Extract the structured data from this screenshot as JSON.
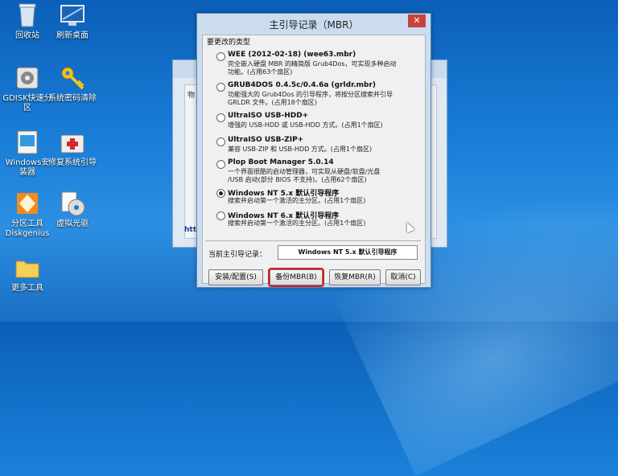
{
  "desktop": {
    "icons": [
      {
        "label": "回收站"
      },
      {
        "label": "刷新桌面"
      },
      {
        "label": "GDISK快速分\n区"
      },
      {
        "label": "系统密码清除"
      },
      {
        "label": "Windows安\n装器"
      },
      {
        "label": "修复系统引导"
      },
      {
        "label": "分区工具\nDiskgenius"
      },
      {
        "label": "虚拟光驱"
      },
      {
        "label": "更多工具"
      }
    ]
  },
  "back_window": {
    "label_fragment": "物",
    "link_fragment": "http"
  },
  "dialog": {
    "title": "主引导记录（MBR）",
    "close_label": "✕",
    "group_title": "要更改的类型",
    "options": [
      {
        "name": "WEE (2012-02-18) (wee63.mbr)",
        "desc": "完全嵌入硬盘 MBR 的精简版 Grub4Dos，可实现多种启动\n功能。(占用63个扇区)",
        "selected": false
      },
      {
        "name": "GRUB4DOS 0.4.5c/0.4.6a (grldr.mbr)",
        "desc": "功能强大的 Grub4Dos 的引导程序，将按分区搜索并引导\nGRLDR 文件。(占用18个扇区)",
        "selected": false
      },
      {
        "name": "UltraISO USB-HDD+",
        "desc": "增强的 USB-HDD 或 USB-HDD 方式。(占用1个扇区)",
        "selected": false
      },
      {
        "name": "UltraISO USB-ZIP+",
        "desc": "兼容 USB-ZIP 和 USB-HDD 方式。(占用1个扇区)",
        "selected": false
      },
      {
        "name": "Plop Boot Manager 5.0.14",
        "desc": "一个界面很酷的启动管理器，可实现从硬盘/软盘/光盘\n/USB 启动(部分 BIOS 不支持)。(占用62个扇区)",
        "selected": false
      },
      {
        "name": "Windows NT 5.x 默认引导程序",
        "desc": "搜索并启动第一个激活的主分区。(占用1个扇区)",
        "selected": true
      },
      {
        "name": "Windows NT 6.x 默认引导程序",
        "desc": "搜索并启动第一个激活的主分区。(占用1个扇区)",
        "selected": false
      }
    ],
    "current_label": "当前主引导记录：",
    "current_value": "Windows NT 5.x 默认引导程序",
    "buttons": {
      "install": "安装/配置(S)",
      "backup": "备份MBR(B)",
      "restore": "恢复MBR(R)",
      "cancel": "取消(C)"
    }
  }
}
